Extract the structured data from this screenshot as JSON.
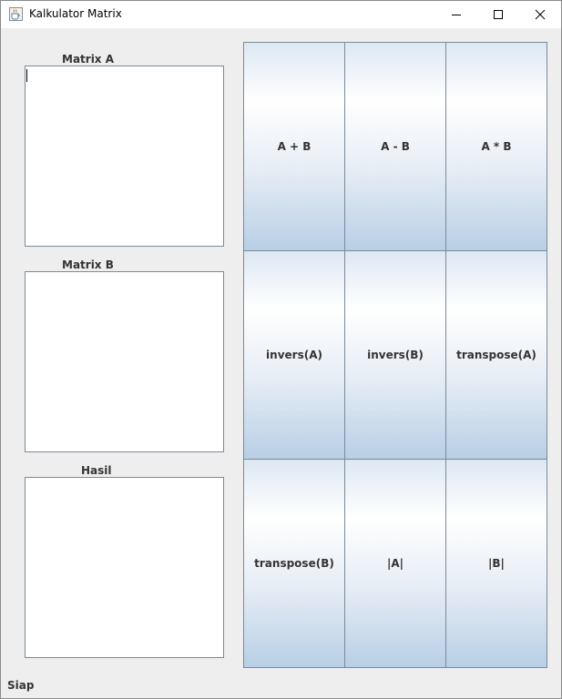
{
  "window": {
    "title": "Kalkulator Matrix"
  },
  "labels": {
    "matrix_a": "Matrix A",
    "matrix_b": "Matrix B",
    "hasil": "Hasil"
  },
  "fields": {
    "matrix_a_value": "",
    "matrix_b_value": "",
    "hasil_value": ""
  },
  "buttons": [
    {
      "label": "A + B"
    },
    {
      "label": "A - B"
    },
    {
      "label": "A * B"
    },
    {
      "label": "invers(A)"
    },
    {
      "label": "invers(B)"
    },
    {
      "label": "transpose(A)"
    },
    {
      "label": "transpose(B)"
    },
    {
      "label": "|A|"
    },
    {
      "label": "|B|"
    }
  ],
  "status": "Siap",
  "icons": {
    "app": "java-cup-icon",
    "minimize": "minimize-icon",
    "maximize": "maximize-icon",
    "close": "close-icon"
  }
}
